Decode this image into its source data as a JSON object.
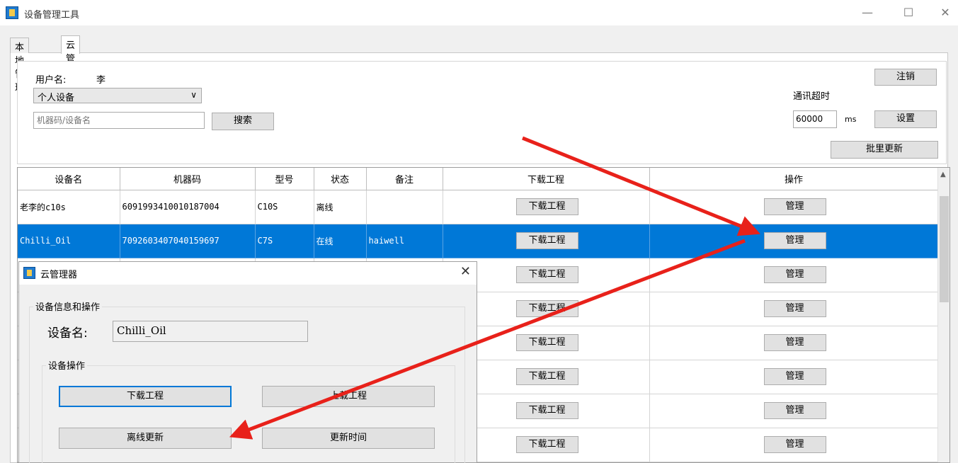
{
  "window": {
    "title": "设备管理工具",
    "minimize": "—",
    "maximize": "☐",
    "close": "✕"
  },
  "tabs": [
    {
      "label": "本地管理"
    },
    {
      "label": "云管理"
    }
  ],
  "account": {
    "username_label": "用户名:",
    "username_value": "李",
    "device_scope": "个人设备",
    "search_placeholder": "机器码/设备名",
    "search_button": "搜索",
    "logout_button": "注销",
    "timeout_label": "通讯超时",
    "timeout_value": "60000",
    "timeout_unit": "ms",
    "set_button": "设置",
    "batch_update_button": "批里更新"
  },
  "table": {
    "columns": [
      "设备名",
      "机器码",
      "型号",
      "状态",
      "备注",
      "下载工程",
      "操作"
    ],
    "download_label": "下载工程",
    "manage_label": "管理",
    "rows": [
      {
        "name": "老李的c10s",
        "code": "6091993410010187004",
        "model": "C10S",
        "status": "离线",
        "note": ""
      },
      {
        "name": "Chilli_Oil",
        "code": "7092603407040159697",
        "model": "C7S",
        "status": "在线",
        "note": "haiwell"
      },
      {
        "name": "",
        "code": "",
        "model": "",
        "status": "",
        "note": ""
      },
      {
        "name": "",
        "code": "",
        "model": "",
        "status": "",
        "note": ""
      },
      {
        "name": "",
        "code": "",
        "model": "",
        "status": "",
        "note": ""
      },
      {
        "name": "",
        "code": "",
        "model": "",
        "status": "",
        "note": ""
      },
      {
        "name": "",
        "code": "",
        "model": "",
        "status": "",
        "note": ""
      },
      {
        "name": "",
        "code": "",
        "model": "",
        "status": "",
        "note": ""
      }
    ],
    "selected_row": 1
  },
  "dialog": {
    "title": "云管理器",
    "close": "✕",
    "group_label": "设备信息和操作",
    "device_name_label": "设备名:",
    "device_name_value": "Chilli_Oil",
    "ops_label": "设备操作",
    "download_button": "下载工程",
    "upload_button": "上载工程",
    "offline_update_button": "离线更新",
    "update_time_button": "更新时间"
  },
  "annotation_color": "#e8211a"
}
